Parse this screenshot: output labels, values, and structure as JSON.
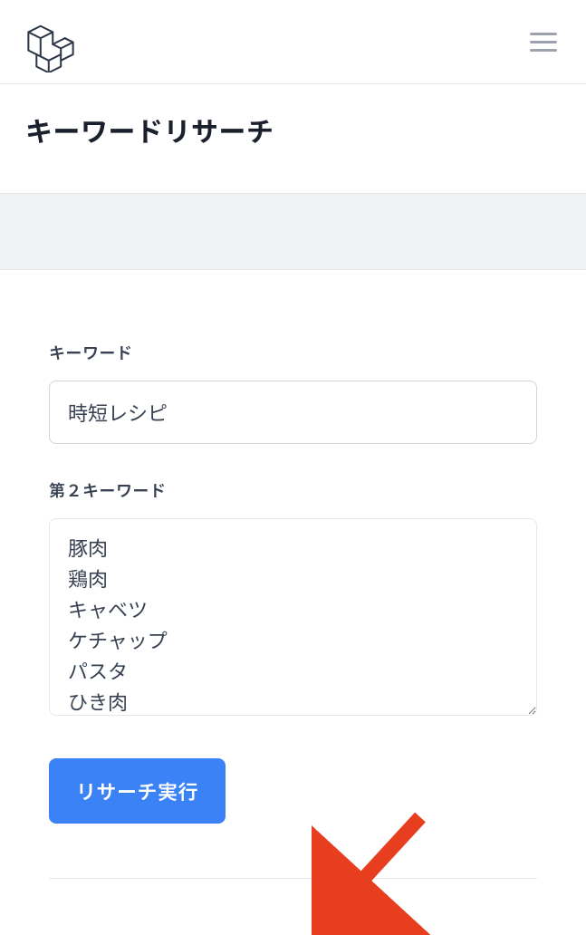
{
  "page": {
    "title": "キーワードリサーチ"
  },
  "form": {
    "keyword_label": "キーワード",
    "keyword_value": "時短レシピ",
    "keyword2_label": "第２キーワード",
    "keyword2_value": "豚肉\n鶏肉\nキャベツ\nケチャップ\nパスタ\nひき肉",
    "submit_label": "リサーチ実行"
  }
}
